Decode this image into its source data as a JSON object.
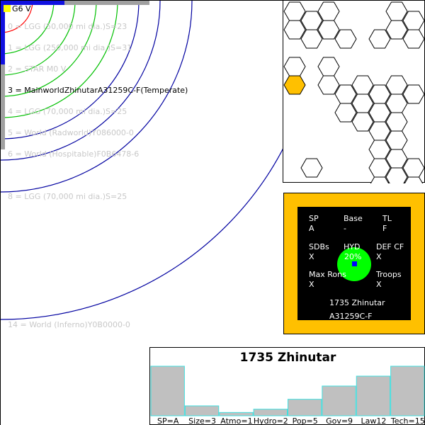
{
  "colors": {
    "orbit_red": "#ff0000",
    "orbit_green": "#00c000",
    "orbit_blue": "#0000a0",
    "star": "#ffff00",
    "selected_hex": "#ffc000",
    "card_bg": "#ffc000",
    "world_disk": "#00ff00",
    "bar_fill": "#c0c0c0",
    "bar_edge": "#40e0e0"
  },
  "system": {
    "star_label": "G6 V",
    "orbits": [
      {
        "label": "0 = LGG (50,000 mi dia.)S=23",
        "active": false
      },
      {
        "label": "1 = LGG (250,000 mi dia.)S=31",
        "active": false
      },
      {
        "label": "2 = STAR M0 V",
        "active": false
      },
      {
        "label": "3 = MainworldZhinutarA31259C-F(Temperate)",
        "active": true
      },
      {
        "label": "4 = LGG (70,000 mi dia.)S=25",
        "active": false
      },
      {
        "label": "5 = World  (Radworld)Y086000-0",
        "active": false
      },
      {
        "label": "6 = World  (Hospitable)F0B6478-6",
        "active": false
      },
      {
        "label": "8 = LGG (70,000 mi dia.)S=25",
        "active": false
      },
      {
        "label": "14 = World  (Inferno)Y0B0000-0",
        "active": false
      }
    ]
  },
  "card": {
    "sp_label": "SP",
    "sp_value": "A",
    "base_label": "Base",
    "base_value": "-",
    "tl_label": "TL",
    "tl_value": "F",
    "sdbs_label": "SDBs",
    "sdbs_value": "X",
    "hyd_label": "HYD",
    "hyd_value": "20%",
    "def_label": "DEF CF",
    "def_value": "X",
    "maxron_label": "Max Rons",
    "maxron_value": "X",
    "troops_label": "Troops",
    "troops_value": "X",
    "name": "1735 Zhinutar",
    "uwp": "A31259C-F"
  },
  "chart_data": {
    "type": "bar",
    "title": "1735 Zhinutar",
    "categories": [
      "SP=A",
      "Size=3",
      "Atmo=1",
      "Hydro=2",
      "Pop=5",
      "Gov=9",
      "Law12",
      "Tech=15"
    ],
    "values": [
      15,
      3,
      1,
      2,
      5,
      9,
      12,
      15
    ],
    "ylim": [
      0,
      15
    ]
  }
}
